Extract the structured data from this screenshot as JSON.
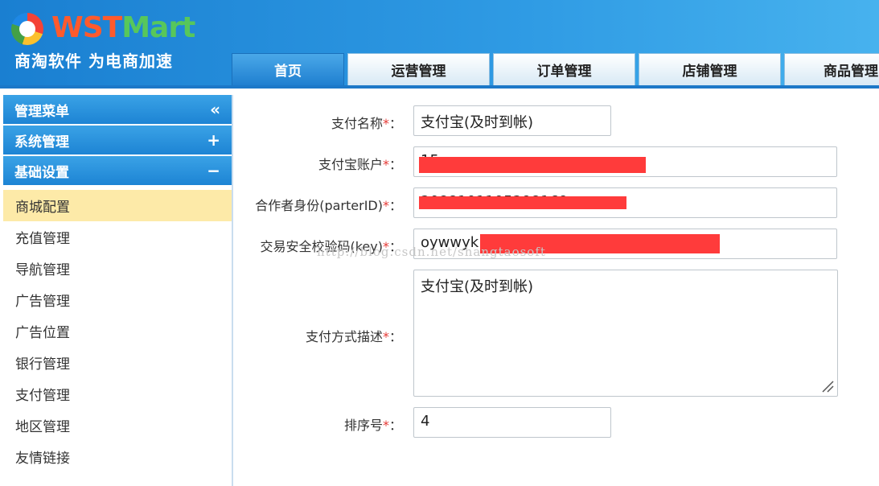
{
  "brand": {
    "logo_text_ws": "WST",
    "logo_text_mart": "Mart",
    "slogan": "商淘软件 为电商加速"
  },
  "nav": {
    "tabs": [
      {
        "label": "首页",
        "active": true
      },
      {
        "label": "运营管理",
        "active": false
      },
      {
        "label": "订单管理",
        "active": false
      },
      {
        "label": "店铺管理",
        "active": false
      },
      {
        "label": "商品管理",
        "active": false
      }
    ]
  },
  "sidebar": {
    "sections": [
      {
        "label": "管理菜单",
        "symbol": "«"
      },
      {
        "label": "系统管理",
        "symbol": "+"
      },
      {
        "label": "基础设置",
        "symbol": "−"
      }
    ],
    "items": [
      {
        "label": "商城配置",
        "active": true
      },
      {
        "label": "充值管理"
      },
      {
        "label": "导航管理"
      },
      {
        "label": "广告管理"
      },
      {
        "label": "广告位置"
      },
      {
        "label": "银行管理"
      },
      {
        "label": "支付管理"
      },
      {
        "label": "地区管理"
      },
      {
        "label": "友情链接"
      }
    ]
  },
  "form": {
    "required_mark": "*",
    "colon": "：",
    "pay_name": {
      "label": "支付名称",
      "value": "支付宝(及时到帐)"
    },
    "alipay_account": {
      "label": "支付宝账户",
      "value": "15"
    },
    "partner_id": {
      "label": "合作者身份(parterID)",
      "value": "2088101105298169"
    },
    "security_key": {
      "label": "交易安全校验码(key)",
      "value": "oywwyk"
    },
    "pay_desc": {
      "label": "支付方式描述",
      "value": "支付宝(及时到帐)"
    },
    "sort_order": {
      "label": "排序号",
      "value": "4"
    }
  },
  "watermark": "http://blog.csdn.net/shangtaosoft",
  "colors": {
    "header_blue": "#1a7fd1",
    "active_item": "#fdeaa8",
    "required": "#e53935",
    "redaction": "#ff3b3b"
  }
}
